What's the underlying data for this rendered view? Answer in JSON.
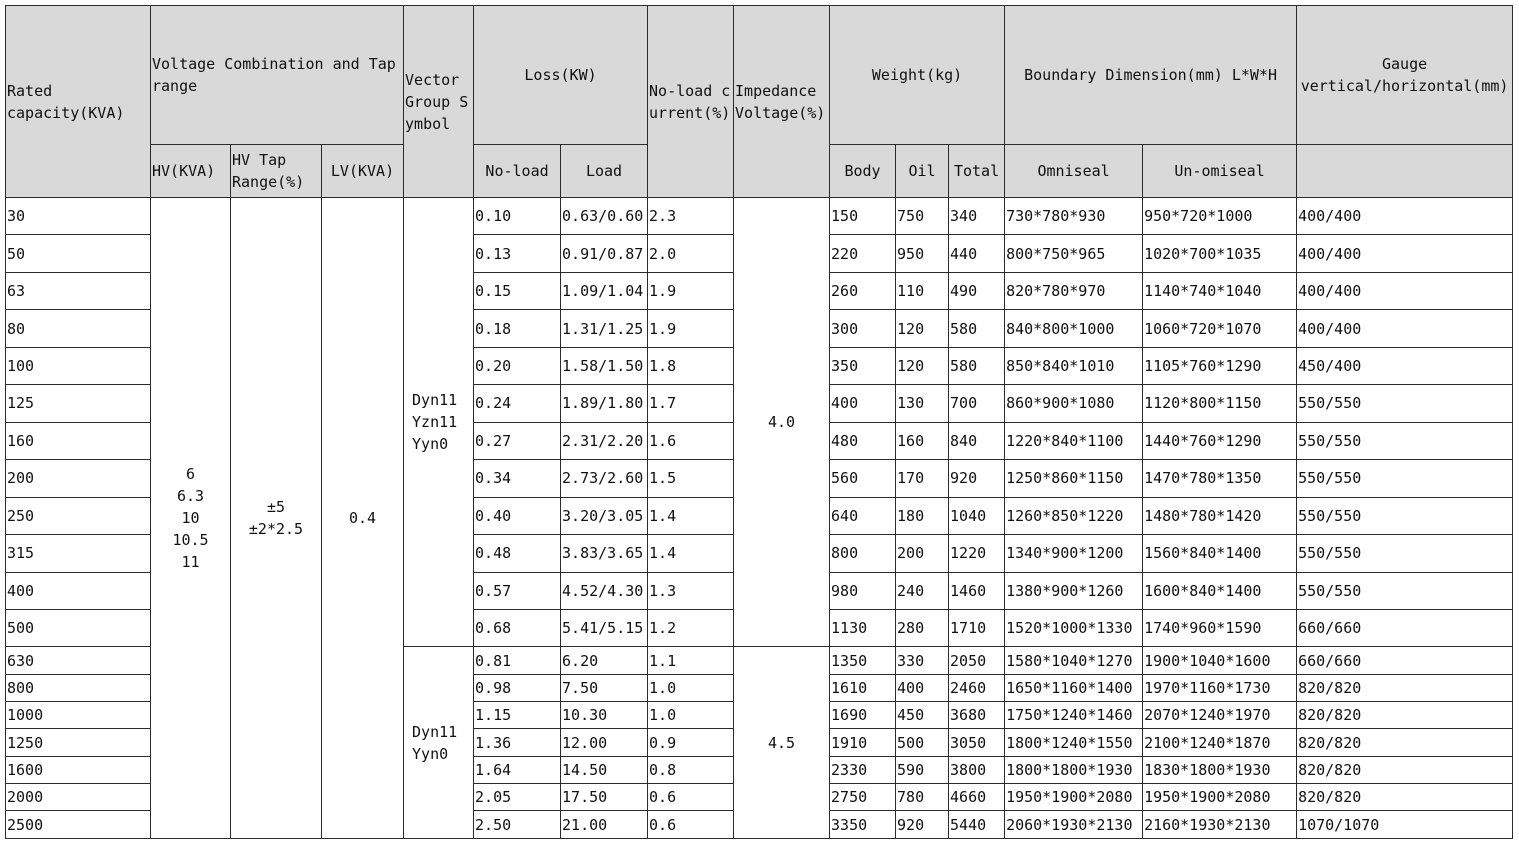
{
  "headers": {
    "rated_capacity": "Rated capacity(KVA)",
    "voltage_combination": "Voltage Combination and Tap range",
    "vector_group": "Vector Group Symbol",
    "loss": "Loss(KW)",
    "no_load_current": "No-load current(%)",
    "impedance_voltage": "Impedance Voltage(%)",
    "weight": "Weight(kg)",
    "boundary_dimension": "Boundary Dimension(mm) L*W*H",
    "gauge": "Gauge vertical/horizontal(mm)",
    "hv": "HV(KVA)",
    "hv_tap_range": "HV Tap Range(%)",
    "lv": "LV(KVA)",
    "loss_no_load": "No-load",
    "loss_load": "Load",
    "body": "Body",
    "oil": "Oil",
    "total": "Total",
    "omniseal": "Omniseal",
    "un_omiseal": "Un-omiseal"
  },
  "merged": {
    "hv_values": [
      "6",
      "6.3",
      "10",
      "10.5",
      "11"
    ],
    "hv_tap_values": [
      "±5",
      "±2*2.5"
    ],
    "lv_value": "0.4",
    "vector_group_1": [
      "Dyn11",
      "Yzn11",
      "Yyn0"
    ],
    "vector_group_2": [
      "Dyn11",
      "Yyn0"
    ],
    "impedance_1": "4.0",
    "impedance_2": "4.5"
  },
  "rows": [
    {
      "capacity": "30",
      "no_load": "0.10",
      "load": "0.63/0.60",
      "current": "2.3",
      "body": "150",
      "oil": "750",
      "total": "340",
      "omniseal": "730*780*930",
      "un_omiseal": "950*720*1000",
      "gauge": "400/400"
    },
    {
      "capacity": "50",
      "no_load": "0.13",
      "load": "0.91/0.87",
      "current": "2.0",
      "body": "220",
      "oil": "950",
      "total": "440",
      "omniseal": "800*750*965",
      "un_omiseal": "1020*700*1035",
      "gauge": "400/400"
    },
    {
      "capacity": "63",
      "no_load": "0.15",
      "load": "1.09/1.04",
      "current": "1.9",
      "body": "260",
      "oil": "110",
      "total": "490",
      "omniseal": "820*780*970",
      "un_omiseal": "1140*740*1040",
      "gauge": "400/400"
    },
    {
      "capacity": "80",
      "no_load": "0.18",
      "load": "1.31/1.25",
      "current": "1.9",
      "body": "300",
      "oil": "120",
      "total": "580",
      "omniseal": "840*800*1000",
      "un_omiseal": "1060*720*1070",
      "gauge": "400/400"
    },
    {
      "capacity": "100",
      "no_load": "0.20",
      "load": "1.58/1.50",
      "current": "1.8",
      "body": "350",
      "oil": "120",
      "total": "580",
      "omniseal": "850*840*1010",
      "un_omiseal": "1105*760*1290",
      "gauge": "450/400"
    },
    {
      "capacity": "125",
      "no_load": "0.24",
      "load": "1.89/1.80",
      "current": "1.7",
      "body": "400",
      "oil": "130",
      "total": "700",
      "omniseal": "860*900*1080",
      "un_omiseal": "1120*800*1150",
      "gauge": "550/550"
    },
    {
      "capacity": "160",
      "no_load": "0.27",
      "load": "2.31/2.20",
      "current": "1.6",
      "body": "480",
      "oil": "160",
      "total": "840",
      "omniseal": "1220*840*1100",
      "un_omiseal": "1440*760*1290",
      "gauge": "550/550"
    },
    {
      "capacity": "200",
      "no_load": "0.34",
      "load": "2.73/2.60",
      "current": "1.5",
      "body": "560",
      "oil": "170",
      "total": "920",
      "omniseal": "1250*860*1150",
      "un_omiseal": "1470*780*1350",
      "gauge": "550/550"
    },
    {
      "capacity": "250",
      "no_load": "0.40",
      "load": "3.20/3.05",
      "current": "1.4",
      "body": "640",
      "oil": "180",
      "total": "1040",
      "omniseal": "1260*850*1220",
      "un_omiseal": "1480*780*1420",
      "gauge": "550/550"
    },
    {
      "capacity": "315",
      "no_load": "0.48",
      "load": "3.83/3.65",
      "current": "1.4",
      "body": "800",
      "oil": "200",
      "total": "1220",
      "omniseal": "1340*900*1200",
      "un_omiseal": "1560*840*1400",
      "gauge": "550/550"
    },
    {
      "capacity": "400",
      "no_load": "0.57",
      "load": "4.52/4.30",
      "current": "1.3",
      "body": "980",
      "oil": "240",
      "total": "1460",
      "omniseal": "1380*900*1260",
      "un_omiseal": "1600*840*1400",
      "gauge": "550/550"
    },
    {
      "capacity": "500",
      "no_load": "0.68",
      "load": "5.41/5.15",
      "current": "1.2",
      "body": "1130",
      "oil": "280",
      "total": "1710",
      "omniseal": "1520*1000*1330",
      "un_omiseal": "1740*960*1590",
      "gauge": "660/660"
    },
    {
      "capacity": "630",
      "no_load": "0.81",
      "load": "6.20",
      "current": "1.1",
      "body": "1350",
      "oil": "330",
      "total": "2050",
      "omniseal": "1580*1040*1270",
      "un_omiseal": "1900*1040*1600",
      "gauge": "660/660"
    },
    {
      "capacity": "800",
      "no_load": "0.98",
      "load": "7.50",
      "current": "1.0",
      "body": "1610",
      "oil": "400",
      "total": "2460",
      "omniseal": "1650*1160*1400",
      "un_omiseal": "1970*1160*1730",
      "gauge": "820/820"
    },
    {
      "capacity": "1000",
      "no_load": "1.15",
      "load": "10.30",
      "current": "1.0",
      "body": "1690",
      "oil": "450",
      "total": "3680",
      "omniseal": "1750*1240*1460",
      "un_omiseal": "2070*1240*1970",
      "gauge": "820/820"
    },
    {
      "capacity": "1250",
      "no_load": "1.36",
      "load": "12.00",
      "current": "0.9",
      "body": "1910",
      "oil": "500",
      "total": "3050",
      "omniseal": "1800*1240*1550",
      "un_omiseal": "2100*1240*1870",
      "gauge": "820/820"
    },
    {
      "capacity": "1600",
      "no_load": "1.64",
      "load": "14.50",
      "current": "0.8",
      "body": "2330",
      "oil": "590",
      "total": "3800",
      "omniseal": "1800*1800*1930",
      "un_omiseal": "1830*1800*1930",
      "gauge": "820/820"
    },
    {
      "capacity": "2000",
      "no_load": "2.05",
      "load": "17.50",
      "current": "0.6",
      "body": "2750",
      "oil": "780",
      "total": "4660",
      "omniseal": "1950*1900*2080",
      "un_omiseal": "1950*1900*2080",
      "gauge": "820/820"
    },
    {
      "capacity": "2500",
      "no_load": "2.50",
      "load": "21.00",
      "current": "0.6",
      "body": "3350",
      "oil": "920",
      "total": "5440",
      "omniseal": "2060*1930*2130",
      "un_omiseal": "2160*1930*2130",
      "gauge": "1070/1070"
    }
  ]
}
